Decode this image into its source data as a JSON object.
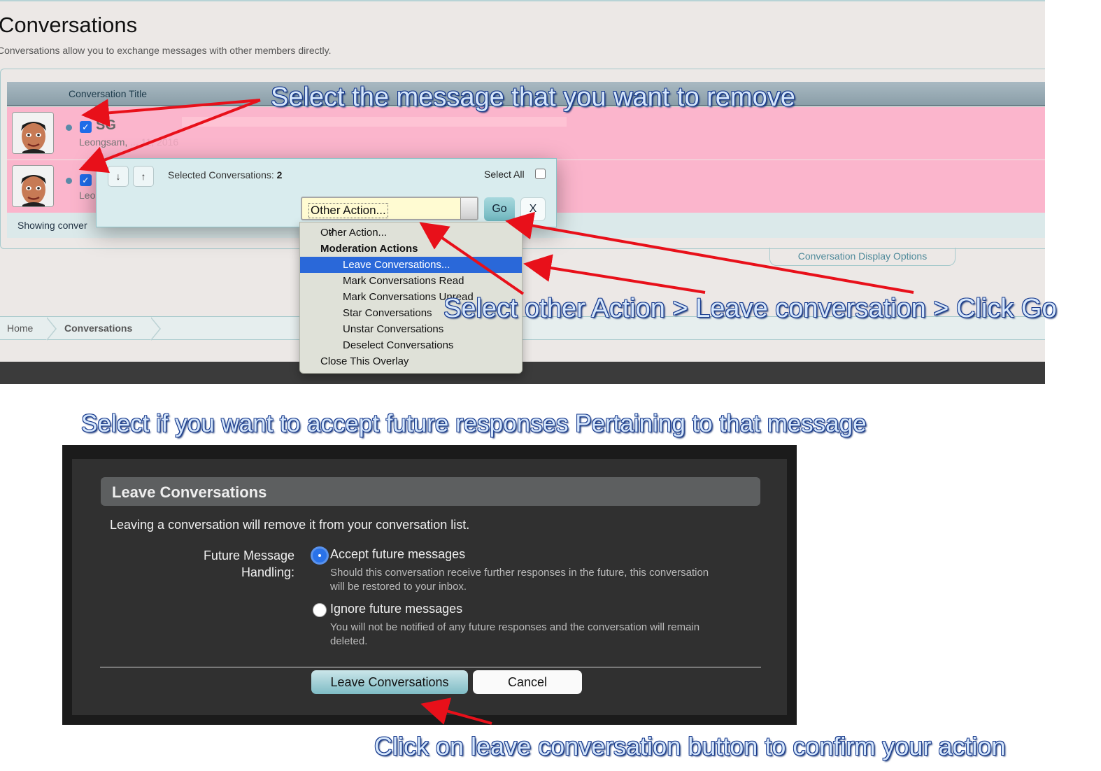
{
  "forum": {
    "page_title": "Conversations",
    "page_description": "Conversations allow you to exchange messages with other members directly.",
    "list_header": "Conversation Title",
    "conversations": [
      {
        "title": "SG",
        "meta_author": "Leongsam,",
        "meta_date": "... 11, 2016"
      },
      {
        "title": "",
        "meta_author": "Leo",
        "meta_date": ""
      }
    ],
    "showing_text": "Showing conver",
    "display_options": "Conversation Display Options",
    "breadcrumb": {
      "home": "Home",
      "current": "Conversations"
    }
  },
  "selection_overlay": {
    "down_arrow": "↓",
    "up_arrow": "↑",
    "selected_label": "Selected Conversations:",
    "selected_count": "2",
    "select_all_label": "Select All",
    "action_value": "Other Action...",
    "go_label": "Go",
    "close_label": "X"
  },
  "dropdown": {
    "items": [
      {
        "label": "Other Action...",
        "checked": true
      },
      {
        "label": "Moderation Actions",
        "header": true
      },
      {
        "label": "Leave Conversations...",
        "highlighted": true
      },
      {
        "label": "Mark Conversations Read"
      },
      {
        "label": "Mark Conversations Unread"
      },
      {
        "label": "Star Conversations"
      },
      {
        "label": "Unstar Conversations"
      },
      {
        "label": "Deselect Conversations"
      },
      {
        "label": "Close This Overlay"
      }
    ]
  },
  "dialog": {
    "title": "Leave Conversations",
    "description": "Leaving a conversation will remove it from your conversation list.",
    "field_label_line1": "Future Message",
    "field_label_line2": "Handling:",
    "accept_label": "Accept future messages",
    "accept_help": "Should this conversation receive further responses in the future, this conversation will be restored to your inbox.",
    "ignore_label": "Ignore future messages",
    "ignore_help": "You will not be notified of any future responses and the conversation will remain deleted.",
    "selected_option": "accept",
    "leave_button": "Leave Conversations",
    "cancel_button": "Cancel"
  },
  "annotations": {
    "select_message": "Select the message that you want to remove",
    "other_action": "Select other Action > Leave conversation > Click Go",
    "accept_future": "Select if you want to accept future responses Pertaining to that message",
    "click_leave": "Click on leave conversation button to confirm your action"
  },
  "colors": {
    "row_highlight": "#fbb5cc",
    "dropdown_selected": "#2a68d9",
    "annotation_arrow": "#e8101a",
    "annotation_outline": "#1b3d8f"
  }
}
